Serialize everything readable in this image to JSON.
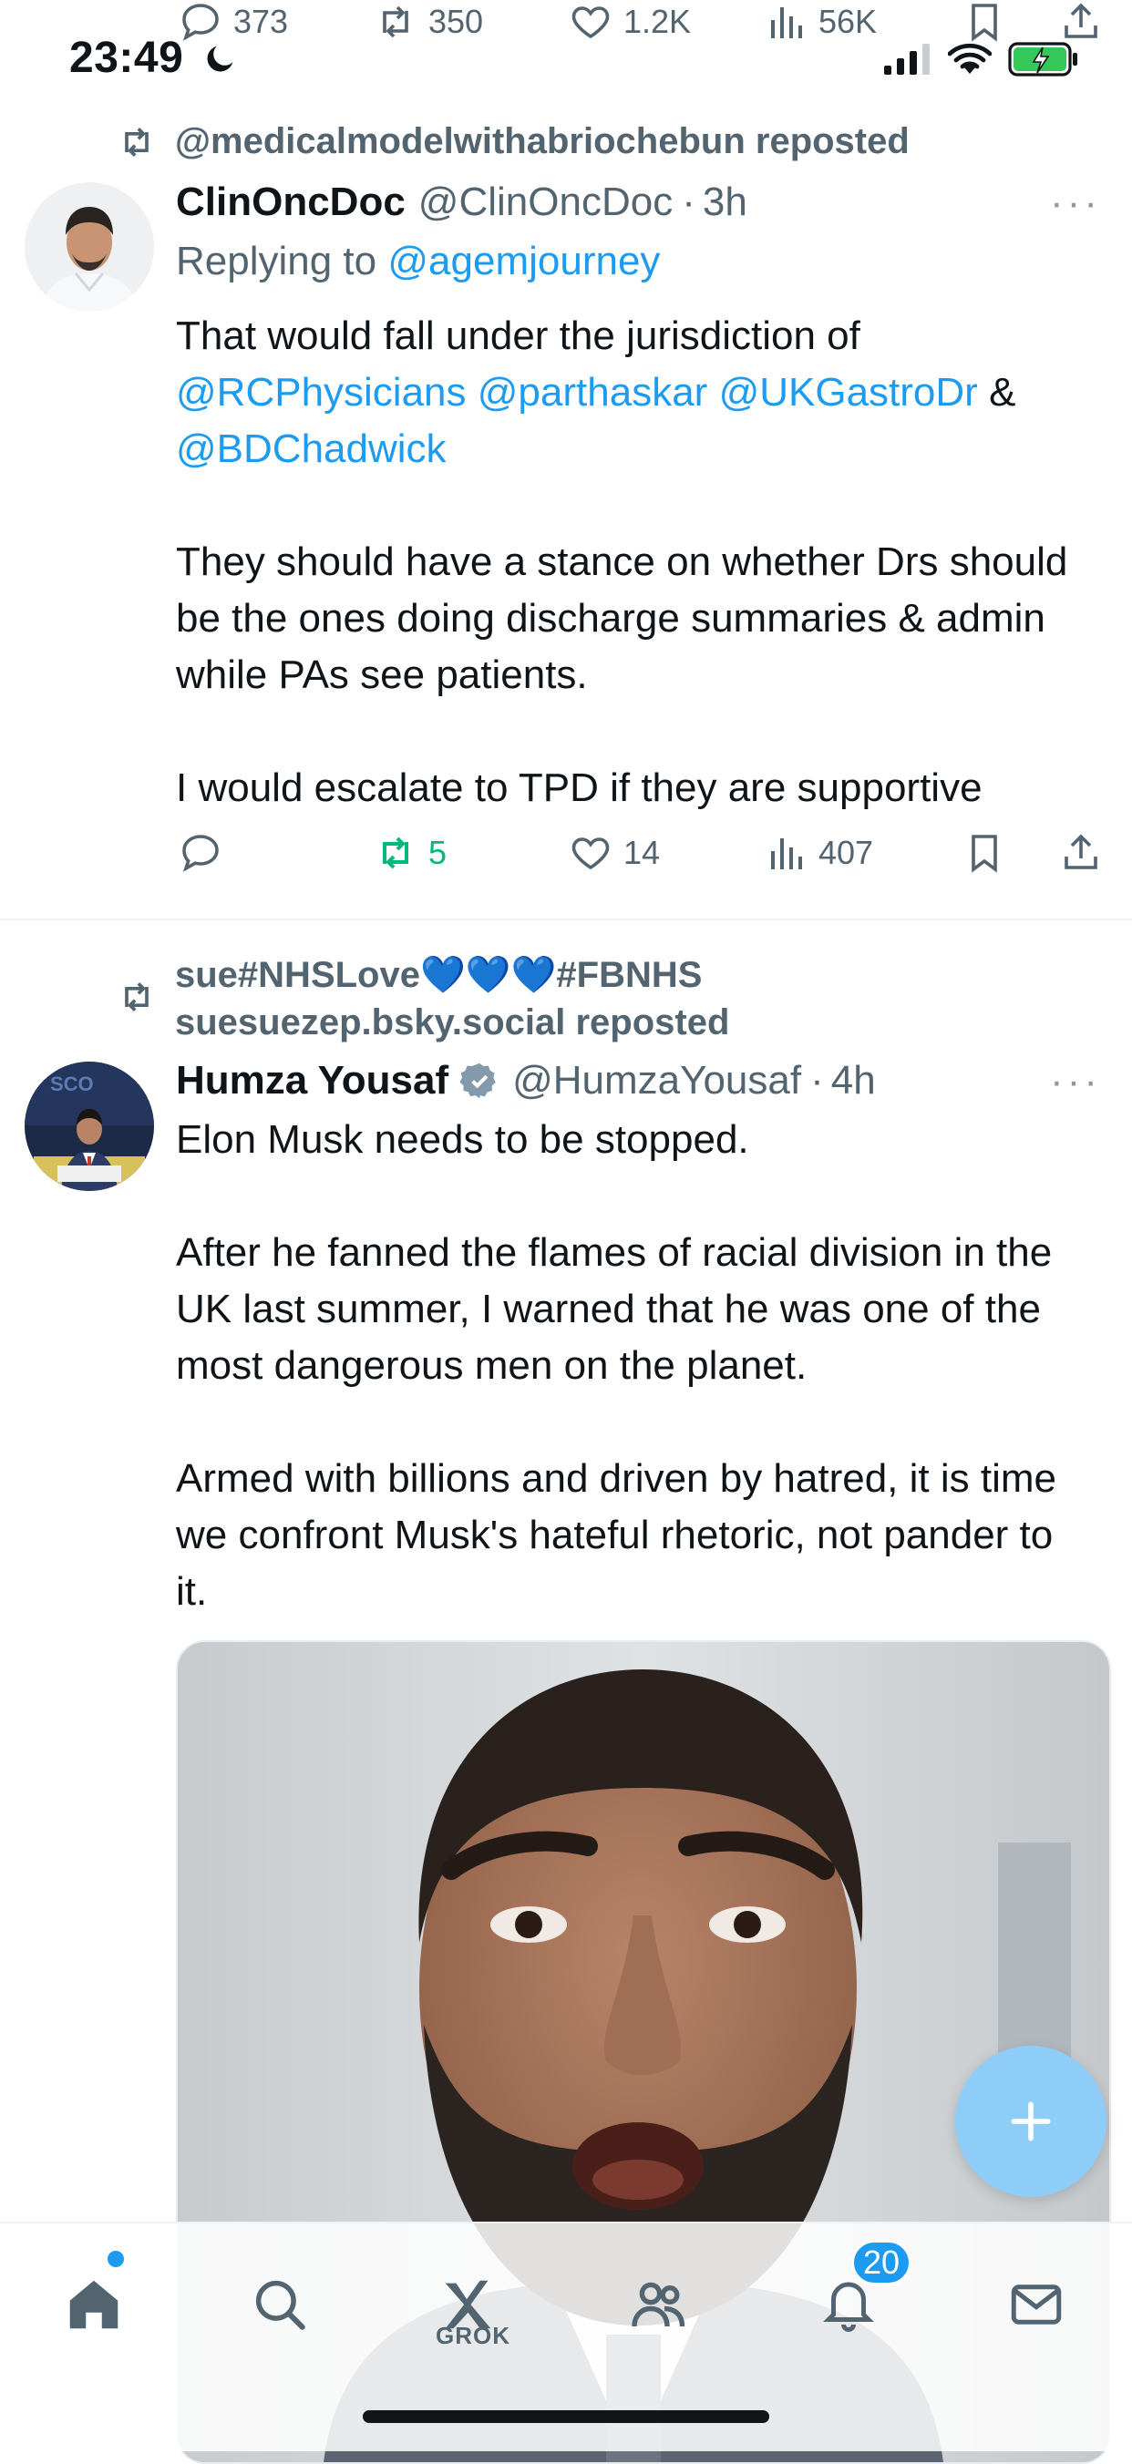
{
  "status_bar": {
    "time": "23:49"
  },
  "top_actions": {
    "replies": "373",
    "reposts": "350",
    "likes": "1.2K",
    "views": "56K"
  },
  "tweets": [
    {
      "repost_line": "@medicalmodelwithabriochebun reposted",
      "name": "ClinOncDoc",
      "handle": "@ClinOncDoc",
      "dot": "·",
      "time": "3h",
      "more": "···",
      "replying_prefix": "Replying to",
      "replying_handle": "@agemjourney",
      "text": {
        "line1": "That would fall under the jurisdiction of",
        "mention1": "@RCPhysicians",
        "mention2": "@parthaskar",
        "mention3": "@UKGastroDr",
        "amp": "&",
        "mention4": "@BDChadwick",
        "para2": "They should have a stance on whether Drs should be the ones doing discharge summaries & admin while PAs see patients.",
        "para3": "I would escalate to TPD if they are supportive"
      },
      "actions": {
        "replies": "",
        "reposts": "5",
        "likes": "14",
        "views": "407"
      },
      "colors": {
        "repost_active": "#00ba7c"
      }
    },
    {
      "repost_line1": "sue#NHSLove💙💙💙#FBNHS",
      "repost_line2": "suesuezep.bsky.social reposted",
      "name": "Humza Yousaf",
      "handle": "@HumzaYousaf",
      "dot": "·",
      "time": "4h",
      "more": "···",
      "text": {
        "para1": "Elon Musk needs to be stopped.",
        "para2": "After he fanned the flames of racial division in the UK last summer, I warned that he was one of the most dangerous men on the planet.",
        "para3": "Armed with billions and driven by hatred, it is time we confront Musk's hateful rhetoric, not pander to it."
      }
    }
  ],
  "bottom_nav": {
    "items": [
      "home-icon",
      "search-icon",
      "grok-icon",
      "communities-icon",
      "notifications-icon",
      "messages-icon"
    ],
    "grok_label": "GROK",
    "notifications_badge": "20"
  },
  "colors": {
    "accent": "#1d9bf0",
    "text": "#0f1419",
    "muted": "#536471",
    "verified": "#829aab"
  }
}
